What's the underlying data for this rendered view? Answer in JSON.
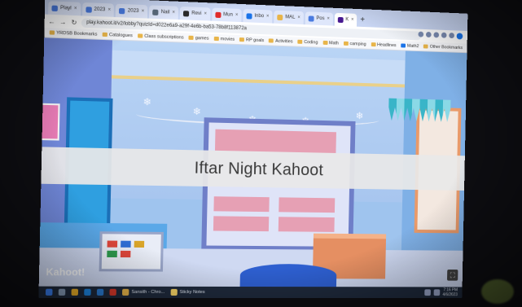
{
  "browser": {
    "tabs": [
      {
        "label": "Playl",
        "active": false
      },
      {
        "label": "2023",
        "active": false
      },
      {
        "label": "2023",
        "active": false
      },
      {
        "label": "Nail",
        "active": false
      },
      {
        "label": "Revi",
        "active": false
      },
      {
        "label": "Mun",
        "active": false
      },
      {
        "label": "Inbo",
        "active": false
      },
      {
        "label": "MAL",
        "active": false
      },
      {
        "label": "Pos",
        "active": false
      },
      {
        "label": "K",
        "active": true
      }
    ],
    "new_tab_label": "+",
    "nav": {
      "back": "←",
      "forward": "→",
      "reload": "↻"
    },
    "url": "play.kahoot.it/v2/lobby?quizId=d022e6a9-a29f-4e6b-ba53-78b8f113872a",
    "bookmarks": [
      "YRDSB Bookmarks",
      "Catalogues",
      "Class subscriptions",
      "games",
      "movies",
      "RP goals",
      "Activities",
      "Coding",
      "Math",
      "camping",
      "Headlines",
      "Math2",
      "Other Bookmarks"
    ],
    "profile_letter": "S"
  },
  "kahoot": {
    "game_title": "Iftar Night Kahoot",
    "logo_text": "Kahoot!",
    "fullscreen_icon": "fullscreen-icon"
  },
  "taskbar": {
    "search_label": "Search",
    "active_app_label": "Sansith - Chro...",
    "notes_label": "Sticky Notes",
    "time": "7:16 PM",
    "date": "4/6/2023"
  },
  "colors": {
    "banner": "#e8e8e8",
    "title_text": "#3a3a3a",
    "wall": "#a8c6ef",
    "board_frame": "#6f7fc8",
    "taskbar": "#1f2a3c"
  }
}
